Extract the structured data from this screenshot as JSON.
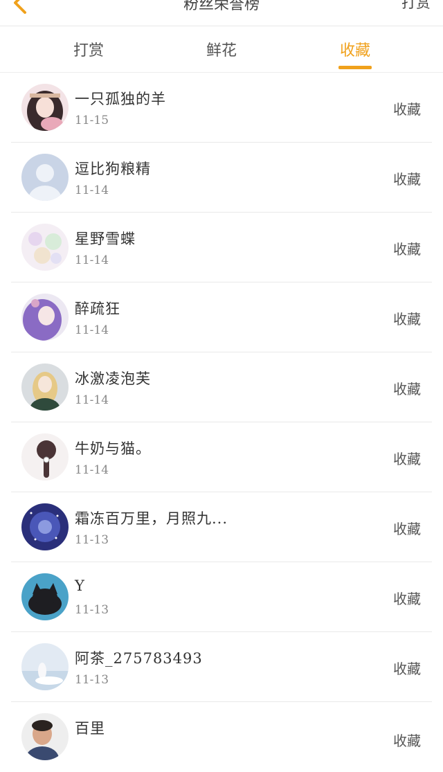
{
  "header": {
    "back_icon": "chevron-left-icon",
    "title": "粉丝荣誉榜",
    "right": "打赏"
  },
  "tabs": [
    {
      "label": "打赏",
      "active": false
    },
    {
      "label": "鲜花",
      "active": false
    },
    {
      "label": "收藏",
      "active": true
    }
  ],
  "accent_color": "#f0a11c",
  "rows": [
    {
      "name": "一只孤独的羊",
      "date": "11-15",
      "action": "收藏",
      "avatar": "anime-girl-avatar"
    },
    {
      "name": "逗比狗粮精",
      "date": "11-14",
      "action": "收藏",
      "avatar": "default-user-avatar"
    },
    {
      "name": "星野雪蝶",
      "date": "11-14",
      "action": "收藏",
      "avatar": "sparkle-avatar"
    },
    {
      "name": "醉疏狂",
      "date": "11-14",
      "action": "收藏",
      "avatar": "purple-hair-avatar"
    },
    {
      "name": "冰激凌泡芙",
      "date": "11-14",
      "action": "收藏",
      "avatar": "blonde-girl-avatar"
    },
    {
      "name": "牛奶与猫。",
      "date": "11-14",
      "action": "收藏",
      "avatar": "ponytail-avatar"
    },
    {
      "name": "霜冻百万里，月照九...",
      "date": "11-13",
      "action": "收藏",
      "avatar": "starry-sky-avatar"
    },
    {
      "name": "Y",
      "date": "11-13",
      "action": "收藏",
      "avatar": "black-cat-avatar"
    },
    {
      "name": "阿茶_275783493",
      "date": "11-13",
      "action": "收藏",
      "avatar": "landscape-avatar"
    },
    {
      "name": "百里",
      "date": "",
      "action": "收藏",
      "avatar": "photo-person-avatar"
    }
  ]
}
